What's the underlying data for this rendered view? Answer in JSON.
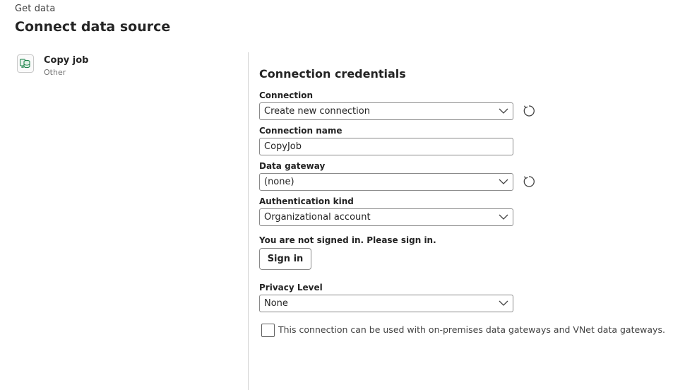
{
  "header": {
    "breadcrumb": "Get data",
    "title": "Connect data source"
  },
  "source": {
    "name": "Copy job",
    "category": "Other",
    "icon": "copy-job-icon"
  },
  "form": {
    "title": "Connection credentials",
    "connection": {
      "label": "Connection",
      "value": "Create new connection"
    },
    "connection_name": {
      "label": "Connection name",
      "value": "CopyJob"
    },
    "data_gateway": {
      "label": "Data gateway",
      "value": "(none)"
    },
    "auth_kind": {
      "label": "Authentication kind",
      "value": "Organizational account"
    },
    "signin_message": "You are not signed in. Please sign in.",
    "signin_button": "Sign in",
    "privacy_level": {
      "label": "Privacy Level",
      "value": "None"
    },
    "gateway_checkbox": {
      "label": "This connection can be used with on-premises data gateways and VNet data gateways.",
      "checked": false
    }
  },
  "colors": {
    "icon_green": "#107c41",
    "border": "#8a8a8a",
    "divider": "#d1d1d1"
  }
}
